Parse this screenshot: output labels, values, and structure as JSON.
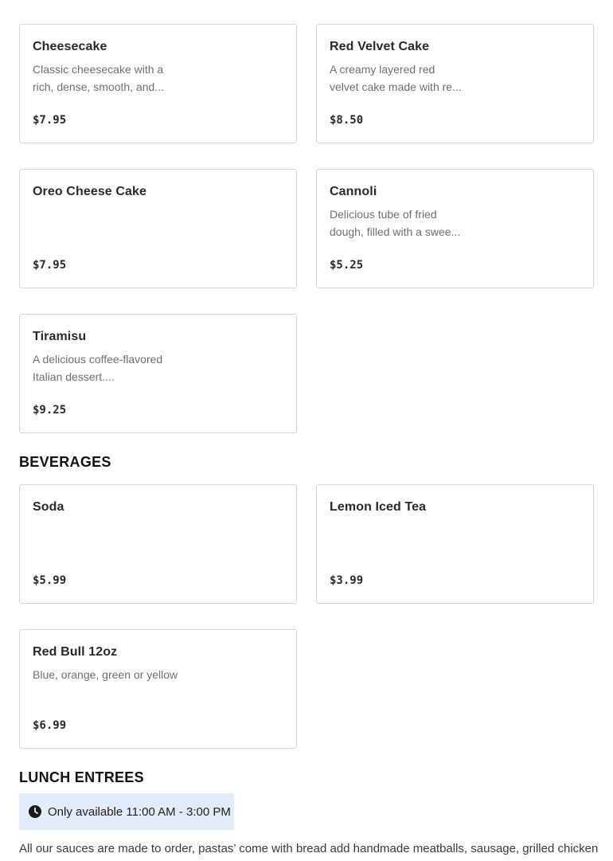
{
  "desserts": [
    {
      "name": "Cheesecake",
      "desc": "Classic cheesecake with a\nrich, dense, smooth, and...",
      "price": "$7.95"
    },
    {
      "name": "Red Velvet Cake",
      "desc": "A creamy layered red\nvelvet cake made with re...",
      "price": "$8.50"
    },
    {
      "name": "Oreo Cheese Cake",
      "desc": "",
      "price": "$7.95"
    },
    {
      "name": "Cannoli",
      "desc": "Delicious tube of fried\ndough, filled with a swee...",
      "price": "$5.25"
    },
    {
      "name": "Tiramisu",
      "desc": "A delicious coffee-flavored\nItalian dessert....",
      "price": "$9.25"
    }
  ],
  "beverages": {
    "title": "BEVERAGES",
    "items": [
      {
        "name": "Soda",
        "desc": "",
        "price": "$5.99"
      },
      {
        "name": "Lemon Iced Tea",
        "desc": "",
        "price": "$3.99"
      },
      {
        "name": "Red Bull 12oz",
        "desc": "Blue, orange, green or yellow",
        "price": "$6.99"
      }
    ]
  },
  "lunch": {
    "title": "LUNCH ENTREES",
    "availability": "Only available 11:00 AM - 3:00 PM",
    "note": "All our sauces are made to order, pastas’ come with bread add handmade meatballs, sausage, grilled chicken or"
  },
  "colors": {
    "availability_bg": "#e2ecf8",
    "card_border": "#d6d6d6"
  }
}
